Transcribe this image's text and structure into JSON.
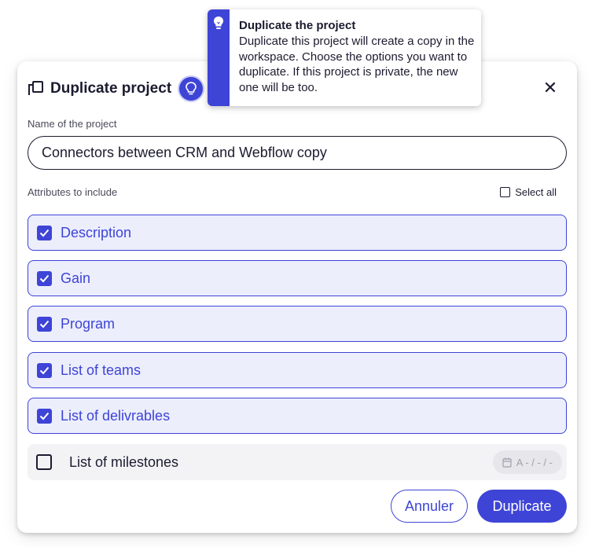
{
  "tooltip": {
    "title": "Duplicate the project",
    "body": "Duplicate this project will create a copy in the workspace. Choose the options you want to duplicate. If this project is private, the new one will be too."
  },
  "dialog": {
    "title": "Duplicate project",
    "name_label": "Name of the project",
    "name_value": "Connectors between CRM and Webflow copy",
    "attributes_label": "Attributes to include",
    "select_all_label": "Select all",
    "attributes": [
      {
        "label": "Description",
        "checked": true
      },
      {
        "label": "Gain",
        "checked": true
      },
      {
        "label": "Program",
        "checked": true
      },
      {
        "label": "List of teams",
        "checked": true
      },
      {
        "label": "List of delivrables",
        "checked": true
      }
    ],
    "milestones": {
      "label": "List of milestones",
      "checked": false,
      "date_placeholder": "A - / - / -"
    },
    "cancel_label": "Annuler",
    "duplicate_label": "Duplicate"
  },
  "colors": {
    "accent": "#3e44d6",
    "accent_light": "#eceefc"
  }
}
